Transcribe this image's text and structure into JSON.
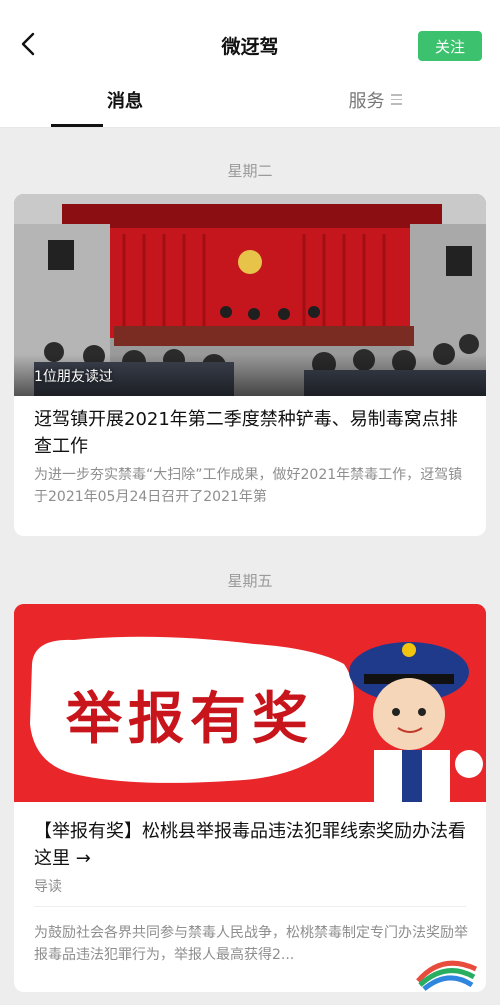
{
  "header": {
    "title": "微迓驾",
    "follow_label": "关注"
  },
  "tabs": [
    {
      "label": "消息",
      "active": true
    },
    {
      "label": "服务",
      "active": false
    }
  ],
  "feed": [
    {
      "date": "星期二",
      "photo_banner_text": "迓驾镇2021年第二季度禁种铲毒和易制毒窝点排查推进会",
      "read_tag": "1位朋友读过",
      "title": "迓驾镇开展2021年第二季度禁种铲毒、易制毒窝点排查工作",
      "desc": "为进一步夯实禁毒“大扫除”工作成果，做好2021年禁毒工作，迓驾镇于2021年05月24日召开了2021年第"
    },
    {
      "date": "星期五",
      "banner_text": "举报有奖",
      "title": "【举报有奖】松桃县举报毒品违法犯罪线索奖励办法看这里 →",
      "guide_label": "导读",
      "desc": "为鼓励社会各界共同参与禁毒人民战争，松桃禁毒制定专门办法奖励举报毒品违法犯罪行为，举报人最高获得2..."
    }
  ],
  "colors": {
    "follow_green": "#3cc26e",
    "background": "#ededed",
    "banner_red": "#e9262a"
  }
}
